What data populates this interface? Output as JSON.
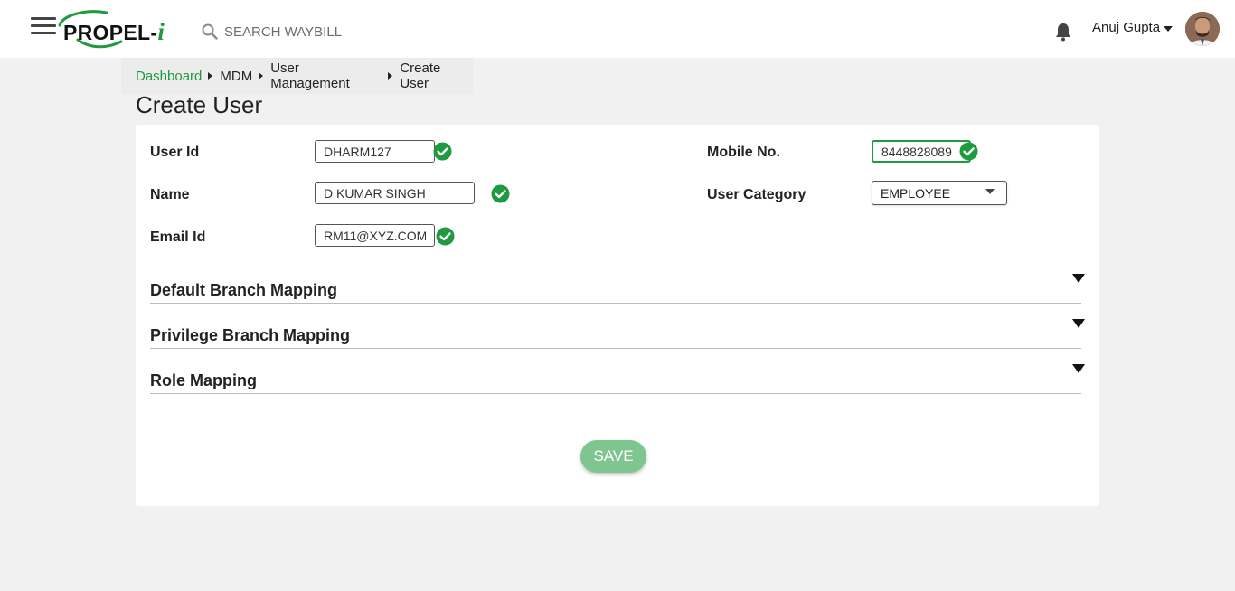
{
  "header": {
    "logo_text": "PROPEL-",
    "logo_accent": "i",
    "search_placeholder": "SEARCH WAYBILL",
    "user_name": "Anuj Gupta"
  },
  "breadcrumb": {
    "items": [
      "Dashboard",
      "MDM",
      "User Management",
      "Create User"
    ]
  },
  "page": {
    "title": "Create User"
  },
  "form": {
    "user_id": {
      "label": "User Id",
      "value": "DHARM127"
    },
    "name": {
      "label": "Name",
      "value": "D KUMAR SINGH"
    },
    "email": {
      "label": "Email Id",
      "value": "RM11@XYZ.COM"
    },
    "mobile": {
      "label": "Mobile No.",
      "value": "8448828089"
    },
    "user_category": {
      "label": "User Category",
      "selected": "EMPLOYEE"
    }
  },
  "sections": [
    {
      "label": "Default Branch Mapping"
    },
    {
      "label": "Privilege Branch Mapping"
    },
    {
      "label": "Role Mapping"
    }
  ],
  "actions": {
    "save_label": "SAVE"
  },
  "colors": {
    "accent": "#1f9a3e",
    "save_button": "#7fc58f",
    "background": "#f1f1f1"
  },
  "icons": [
    "menu-icon",
    "search-icon",
    "bell-icon",
    "chevron-down-icon",
    "check-circle-icon",
    "triangle-down-icon"
  ]
}
